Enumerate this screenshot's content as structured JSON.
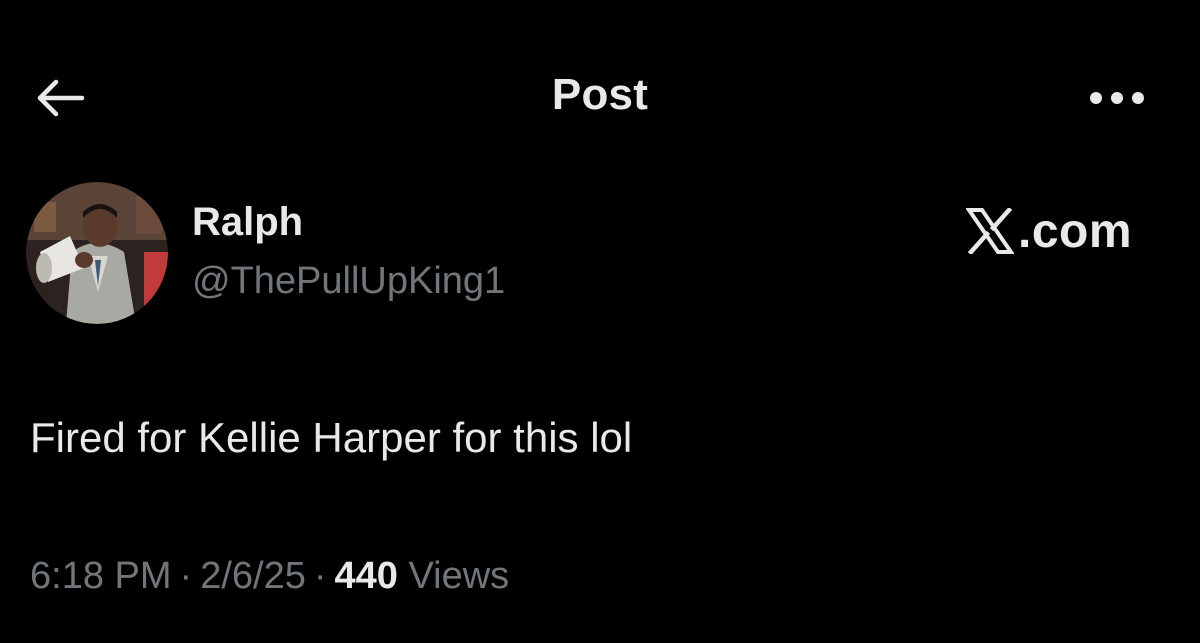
{
  "header": {
    "title": "Post",
    "back_icon": "arrow-left-icon",
    "more_icon": "more-horizontal-icon"
  },
  "post": {
    "author": {
      "name": "Ralph",
      "handle": "@ThePullUpKing1",
      "avatar_icon": "avatar-photo"
    },
    "brand": {
      "logo_icon": "x-logo-icon",
      "text": ".com"
    },
    "text": "Fired for Kellie Harper for this lol",
    "meta": {
      "time": "6:18 PM",
      "separator": "·",
      "date": "2/6/25",
      "views_count": "440",
      "views_label": "Views"
    }
  },
  "colors": {
    "background": "#000000",
    "primary_text": "#e7e9ea",
    "secondary_text": "#71767b"
  }
}
